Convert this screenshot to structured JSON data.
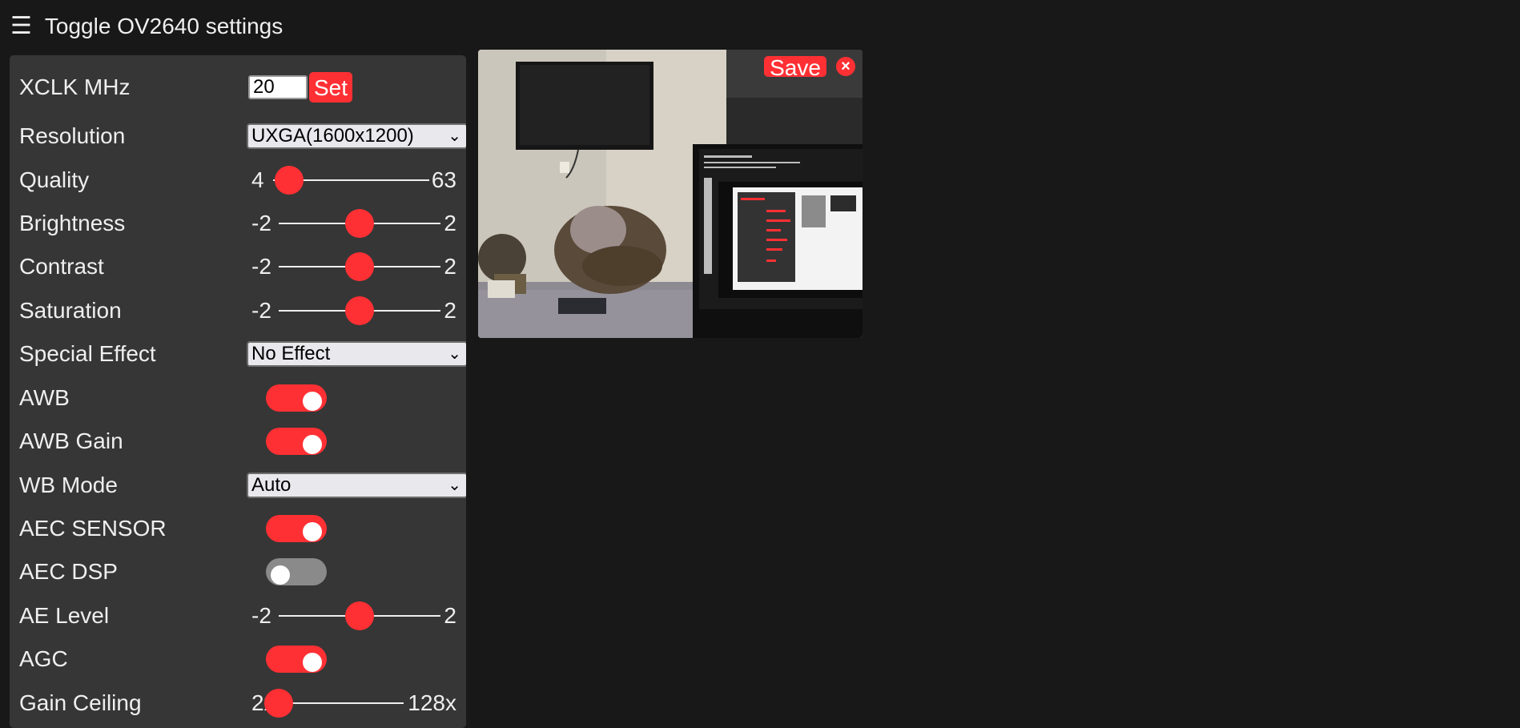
{
  "header": {
    "menu_icon": "hamburger-menu-icon",
    "menu_glyph": "☰",
    "title": "Toggle OV2640 settings"
  },
  "settings": {
    "xclk": {
      "label": "XCLK MHz",
      "value": "20",
      "button": "Set"
    },
    "resolution": {
      "label": "Resolution",
      "selected": "UXGA(1600x1200)"
    },
    "quality": {
      "label": "Quality",
      "min": "4",
      "max": "63",
      "value": 10
    },
    "brightness": {
      "label": "Brightness",
      "min": "-2",
      "max": "2",
      "value": 0
    },
    "contrast": {
      "label": "Contrast",
      "min": "-2",
      "max": "2",
      "value": 0
    },
    "saturation": {
      "label": "Saturation",
      "min": "-2",
      "max": "2",
      "value": 0
    },
    "special_effect": {
      "label": "Special Effect",
      "selected": "No Effect"
    },
    "awb": {
      "label": "AWB",
      "on": true
    },
    "awb_gain": {
      "label": "AWB Gain",
      "on": true
    },
    "wb_mode": {
      "label": "WB Mode",
      "selected": "Auto"
    },
    "aec_sensor": {
      "label": "AEC SENSOR",
      "on": true
    },
    "aec_dsp": {
      "label": "AEC DSP",
      "on": false
    },
    "ae_level": {
      "label": "AE Level",
      "min": "-2",
      "max": "2",
      "value": 0
    },
    "agc": {
      "label": "AGC",
      "on": true
    },
    "gain_ceiling": {
      "label": "Gain Ceiling",
      "min": "2x",
      "max": "128x",
      "value": 0
    }
  },
  "stream": {
    "save_label": "Save",
    "close_glyph": "×",
    "close_icon": "close-icon"
  },
  "colors": {
    "accent": "#ff3034",
    "background": "#181818",
    "panel": "#363636"
  }
}
